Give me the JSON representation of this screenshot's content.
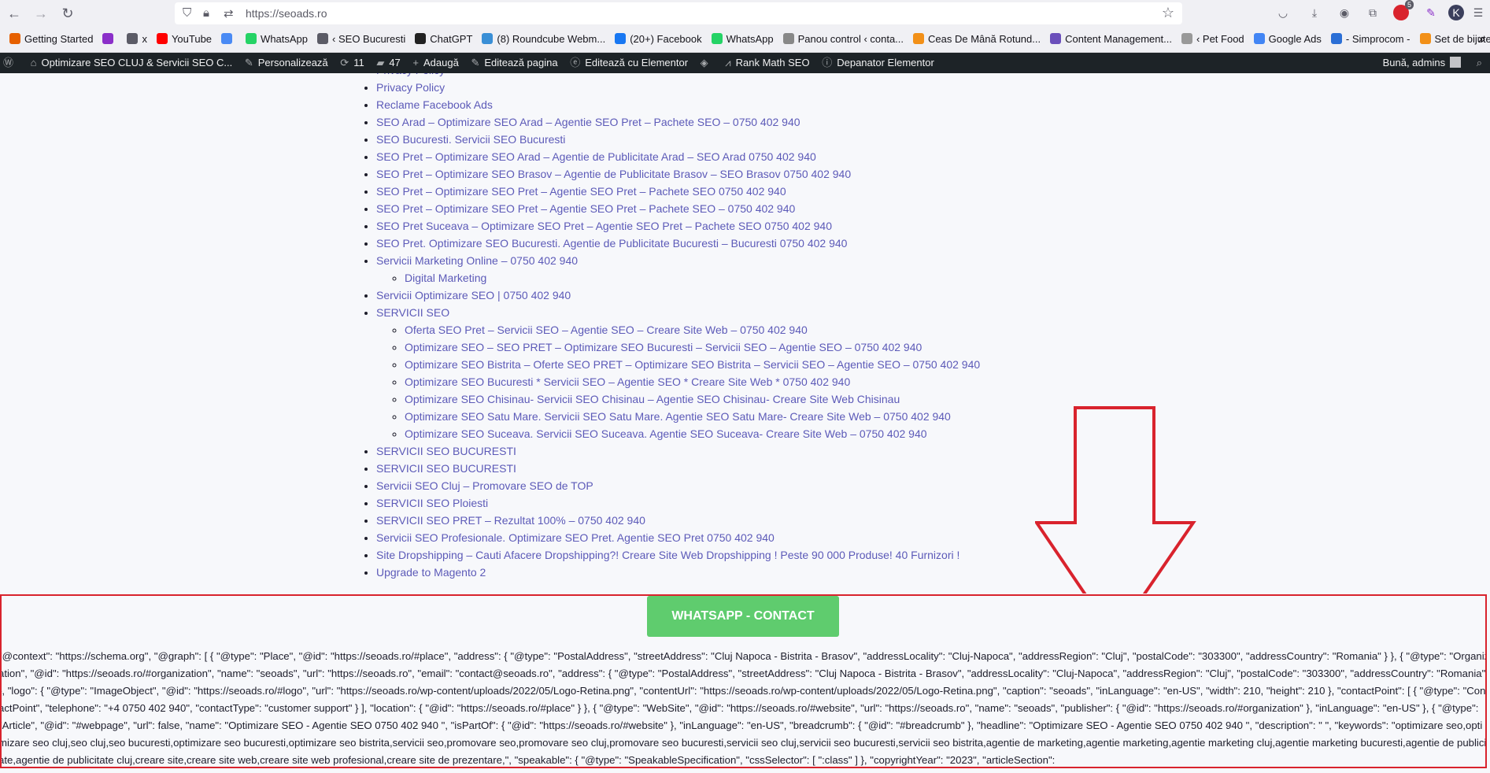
{
  "browser": {
    "url": "https://seoads.ro",
    "extension_badge": "5"
  },
  "bookmarks": [
    {
      "label": "Getting Started",
      "color": "#e66000"
    },
    {
      "label": "",
      "color": "#8b2fc9"
    },
    {
      "label": "x",
      "color": "#5b5b66"
    },
    {
      "label": "YouTube",
      "color": "#ff0000"
    },
    {
      "label": "",
      "color": "#4a8af4"
    },
    {
      "label": "WhatsApp",
      "color": "#25d366"
    },
    {
      "label": "‹ SEO Bucuresti",
      "color": "#5b5b66"
    },
    {
      "label": "ChatGPT",
      "color": "#222222"
    },
    {
      "label": "(8) Roundcube Webm...",
      "color": "#3a8fd6"
    },
    {
      "label": "(20+) Facebook",
      "color": "#1877f2"
    },
    {
      "label": "WhatsApp",
      "color": "#25d366"
    },
    {
      "label": "Panou control ‹ conta...",
      "color": "#888888"
    },
    {
      "label": "Ceas De Mână Rotund...",
      "color": "#f29018"
    },
    {
      "label": "Content Management...",
      "color": "#6b4fbb"
    },
    {
      "label": "‹ Pet Food",
      "color": "#999999"
    },
    {
      "label": "Google Ads",
      "color": "#4285f4"
    },
    {
      "label": "- Simprocom -",
      "color": "#2b6fd6"
    },
    {
      "label": "Set de bijuterii de lux c...",
      "color": "#f29018"
    }
  ],
  "adminbar": {
    "site_name": "Optimizare SEO CLUJ & Servicii SEO C...",
    "customize": "Personalizează",
    "updates_count": "11",
    "comments_count": "47",
    "add_new": "Adaugă",
    "edit_page": "Editează pagina",
    "edit_elementor": "Editează cu Elementor",
    "rank_math": "Rank Math SEO",
    "debugger": "Depanator Elementor",
    "greeting": "Bună, admins"
  },
  "sitemap": [
    {
      "label": "Privacy Policy",
      "children": []
    },
    {
      "label": "Privacy Policy",
      "children": []
    },
    {
      "label": "Reclame Facebook Ads",
      "children": []
    },
    {
      "label": "SEO Arad – Optimizare SEO Arad – Agentie SEO Pret – Pachete SEO – 0750 402 940",
      "children": []
    },
    {
      "label": "SEO Bucuresti. Servicii SEO Bucuresti",
      "children": []
    },
    {
      "label": "SEO Pret – Optimizare SEO Arad – Agentie de Publicitate Arad – SEO Arad 0750 402 940",
      "children": []
    },
    {
      "label": "SEO Pret – Optimizare SEO Brasov – Agentie de Publicitate Brasov – SEO Brasov 0750 402 940",
      "children": []
    },
    {
      "label": "SEO Pret – Optimizare SEO Pret – Agentie SEO Pret – Pachete SEO 0750 402 940",
      "children": []
    },
    {
      "label": "SEO Pret – Optimizare SEO Pret – Agentie SEO Pret – Pachete SEO – 0750 402 940",
      "children": []
    },
    {
      "label": "SEO Pret Suceava – Optimizare SEO Pret – Agentie SEO Pret – Pachete SEO 0750 402 940",
      "children": []
    },
    {
      "label": "SEO Pret. Optimizare SEO Bucuresti. Agentie de Publicitate Bucuresti – Bucuresti 0750 402 940",
      "children": []
    },
    {
      "label": "Servicii Marketing Online – 0750 402 940",
      "children": [
        {
          "label": "Digital Marketing"
        }
      ]
    },
    {
      "label": "Servicii Optimizare SEO | 0750 402 940",
      "children": []
    },
    {
      "label": "SERVICII SEO",
      "children": [
        {
          "label": "Oferta SEO Pret – Servicii SEO – Agentie SEO – Creare Site Web – 0750 402 940"
        },
        {
          "label": "Optimizare SEO – SEO PRET – Optimizare SEO Bucuresti – Servicii SEO – Agentie SEO – 0750 402 940"
        },
        {
          "label": "Optimizare SEO Bistrita – Oferte SEO PRET – Optimizare SEO Bistrita – Servicii SEO – Agentie SEO – 0750 402 940"
        },
        {
          "label": "Optimizare SEO Bucuresti * Servicii SEO – Agentie SEO * Creare Site Web * 0750 402 940"
        },
        {
          "label": "Optimizare SEO Chisinau- Servicii SEO Chisinau – Agentie SEO Chisinau- Creare Site Web Chisinau"
        },
        {
          "label": "Optimizare SEO Satu Mare. Servicii SEO Satu Mare. Agentie SEO Satu Mare- Creare Site Web – 0750 402 940"
        },
        {
          "label": "Optimizare SEO Suceava. Servicii SEO Suceava. Agentie SEO Suceava- Creare Site Web – 0750 402 940"
        }
      ]
    },
    {
      "label": "SERVICII SEO BUCURESTI",
      "children": []
    },
    {
      "label": "SERVICII SEO BUCURESTI",
      "children": []
    },
    {
      "label": "Servicii SEO Cluj – Promovare SEO de TOP",
      "children": []
    },
    {
      "label": "SERVICII SEO Ploiesti",
      "children": []
    },
    {
      "label": "SERVICII SEO PRET – Rezultat 100% – 0750 402 940",
      "children": []
    },
    {
      "label": "Servicii SEO Profesionale. Optimizare SEO Pret. Agentie SEO Pret 0750 402 940",
      "children": []
    },
    {
      "label": "Site Dropshipping – Cauti Afacere Dropshipping?! Creare Site Web Dropshipping ! Peste 90 000 Produse! 40 Furnizori !",
      "children": []
    },
    {
      "label": "Upgrade to Magento 2",
      "children": []
    }
  ],
  "whatsapp_button": "WHATSAPP - CONTACT",
  "schema_text": "\"@context\": \"https://schema.org\", \"@graph\": [ { \"@type\": \"Place\", \"@id\": \"https://seoads.ro/#place\", \"address\": { \"@type\": \"PostalAddress\", \"streetAddress\": \"Cluj Napoca - Bistrita - Brasov\", \"addressLocality\": \"Cluj-Napoca\", \"addressRegion\": \"Cluj\", \"postalCode\": \"303300\", \"addressCountry\": \"Romania\" } }, { \"@type\": \"Organization\", \"@id\": \"https://seoads.ro/#organization\", \"name\": \"seoads\", \"url\": \"https://seoads.ro\", \"email\": \"contact@seoads.ro\", \"address\": { \"@type\": \"PostalAddress\", \"streetAddress\": \"Cluj Napoca - Bistrita - Brasov\", \"addressLocality\": \"Cluj-Napoca\", \"addressRegion\": \"Cluj\", \"postalCode\": \"303300\", \"addressCountry\": \"Romania\" }, \"logo\": { \"@type\": \"ImageObject\", \"@id\": \"https://seoads.ro/#logo\", \"url\": \"https://seoads.ro/wp-content/uploads/2022/05/Logo-Retina.png\", \"contentUrl\": \"https://seoads.ro/wp-content/uploads/2022/05/Logo-Retina.png\", \"caption\": \"seoads\", \"inLanguage\": \"en-US\", \"width\": 210, \"height\": 210 }, \"contactPoint\": [ { \"@type\": \"ContactPoint\", \"telephone\": \"+4 0750 402 940\", \"contactType\": \"customer support\" } ], \"location\": { \"@id\": \"https://seoads.ro/#place\" } }, { \"@type\": \"WebSite\", \"@id\": \"https://seoads.ro/#website\", \"url\": \"https://seoads.ro\", \"name\": \"seoads\", \"publisher\": { \"@id\": \"https://seoads.ro/#organization\" }, \"inLanguage\": \"en-US\" }, { \"@type\": \"Article\", \"@id\": \"#webpage\", \"url\": false, \"name\": \"Optimizare SEO - Agentie SEO 0750 402 940 \", \"isPartOf\": { \"@id\": \"https://seoads.ro/#website\" }, \"inLanguage\": \"en-US\", \"breadcrumb\": { \"@id\": \"#breadcrumb\" }, \"headline\": \"Optimizare SEO - Agentie SEO 0750 402 940 \", \"description\": \" \", \"keywords\": \"optimizare seo,optimizare seo cluj,seo cluj,seo bucuresti,optimizare seo bucuresti,optimizare seo bistrita,servicii seo,promovare seo,promovare seo cluj,promovare seo bucuresti,servicii seo cluj,servicii seo bucuresti,servicii seo bistrita,agentie de marketing,agentie marketing,agentie marketing cluj,agentie marketing bucuresti,agentie de publicitate,agentie de publicitate cluj,creare site,creare site web,creare site web profesional,creare site de prezentare,\", \"speakable\": { \"@type\": \"SpeakableSpecification\", \"cssSelector\": [ \":class\" ] }, \"copyrightYear\": \"2023\", \"articleSection\":"
}
